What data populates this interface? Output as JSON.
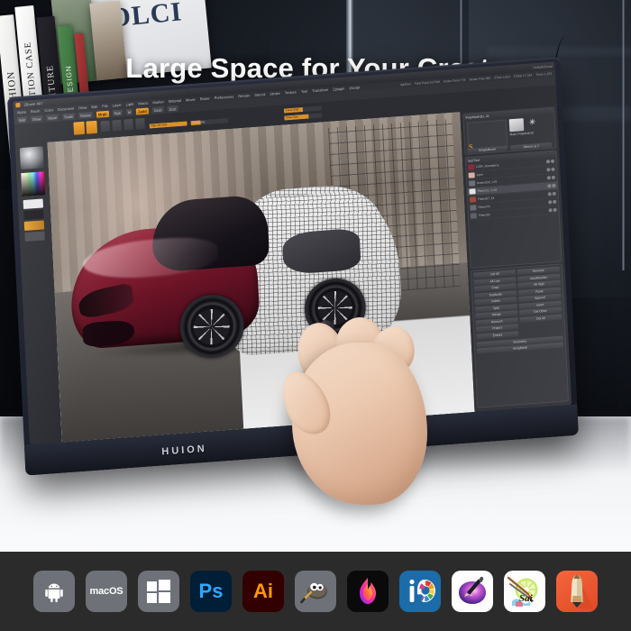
{
  "headline": "Large Space for Your Create",
  "brand": {
    "tablet_logo": "HUION"
  },
  "background": {
    "books": [
      {
        "title": "FASHION",
        "color": "#efefee",
        "text_color": "#1c1c22"
      },
      {
        "title": "DECORATION CASE",
        "color": "#f2f2f1",
        "text_color": "#20202a"
      },
      {
        "title": "FURNITURE",
        "color": "#1d1d22",
        "text_color": "#e8e8ea"
      },
      {
        "title": "About Design",
        "color": "#3b6b3e",
        "text_color": "#f0f0ea"
      },
      {
        "title": "DOLCI",
        "color": "#e9eaec",
        "text_color": "#2a3a55"
      }
    ],
    "magazine_title": "DOLCI"
  },
  "zbrush": {
    "window_title": "ZBrush 4R7",
    "menu_items": [
      "Alpha",
      "Brush",
      "Color",
      "Document",
      "Draw",
      "Edit",
      "File",
      "Layer",
      "Light",
      "Macro",
      "Marker",
      "Material",
      "Movie",
      "Picker",
      "Preferences",
      "Render",
      "Stencil",
      "Stroke",
      "Texture",
      "Tool",
      "Transform",
      "Zplugin",
      "Zscript"
    ],
    "status": {
      "tool": "lightbox",
      "total_points": "Total Point 3,072M",
      "active_points": "Active Point 778",
      "stroke_poly": "Stroke Poly 382",
      "ztools": "ZTool 1,024",
      "ztotal": "ZTotal 17,324",
      "ztime": "Timer 1,152"
    },
    "shelf_items": [
      "Edit",
      "Draw",
      "Move",
      "Scale",
      "Rotate",
      "Mrgb",
      "Rgb",
      "M",
      "Zadd",
      "Zsub",
      "Focal Shift",
      "Draw Size",
      "Z Intensity"
    ],
    "sliders": [
      {
        "label": "Rgb Intensity",
        "value": "100"
      },
      {
        "label": "Z Intensity",
        "value": "25"
      },
      {
        "label": "Focal Shift",
        "value": "0"
      },
      {
        "label": "Draw Size",
        "value": "64"
      }
    ],
    "toggles": [
      "Mrgb",
      "Rgb",
      "M",
      "Zadd",
      "Zsub",
      "Zcut"
    ],
    "subtool_panel": {
      "title": "SubTool",
      "tool_title": "PolyMesh3D_41",
      "tool_buttons": [
        "Copy Tool",
        "Import",
        "Export",
        "Clone",
        "Make PolyMesh3D",
        "SimpleBrush",
        "Fibers1 & 2"
      ],
      "items": [
        {
          "name": "COR_strawberry",
          "visible": true
        },
        {
          "name": "eyes",
          "visible": true
        },
        {
          "name": "lensesCol_L01",
          "visible": true
        },
        {
          "name": "Fibers11_Cut1",
          "visible": true,
          "selected": true
        },
        {
          "name": "Fibers07_Di",
          "visible": true
        },
        {
          "name": "Fibers70",
          "visible": true
        },
        {
          "name": "Fibers62",
          "visible": true
        }
      ]
    },
    "subtool_actions": [
      [
        "List All",
        "Rename"
      ],
      [
        "All Low",
        "AutoReorder"
      ],
      [
        "Copy",
        "All High"
      ],
      [
        "Duplicate",
        "Paste"
      ],
      [
        "Delete",
        "Append"
      ],
      [
        "Split",
        "Insert"
      ],
      [
        "Merge",
        "Del Other"
      ],
      [
        "Remesh",
        "Del All"
      ],
      [
        "Project",
        ""
      ],
      [
        "Extract",
        ""
      ],
      [
        "Geometry",
        ""
      ],
      [
        "ArrayMesh",
        ""
      ]
    ],
    "canvas_object": "Sports car model, half rendered / half wireframe"
  },
  "appbar": {
    "apps": [
      {
        "name": "android",
        "icon": "android-icon",
        "label": ""
      },
      {
        "name": "macos",
        "icon": "macos-icon",
        "label": "macOS"
      },
      {
        "name": "windows",
        "icon": "windows-icon",
        "label": ""
      },
      {
        "name": "photoshop",
        "icon": "photoshop-icon",
        "label": "Ps"
      },
      {
        "name": "illustrator",
        "icon": "illustrator-icon",
        "label": "Ai"
      },
      {
        "name": "gimp",
        "icon": "gimp-icon",
        "label": ""
      },
      {
        "name": "infinite-painter",
        "icon": "flame-icon",
        "label": ""
      },
      {
        "name": "ibis-paint",
        "icon": "ibispaint-icon",
        "label": "iP"
      },
      {
        "name": "krita",
        "icon": "krita-icon",
        "label": ""
      },
      {
        "name": "paint-tool-sai",
        "icon": "sai-icon",
        "label": "Sai"
      },
      {
        "name": "sketchbook",
        "icon": "sketchbook-icon",
        "label": ""
      }
    ]
  },
  "colors": {
    "appbar_bg": "#2b2b2b",
    "headline": "#ffffff",
    "zbrush_accent": "#e09a28",
    "car_body": "#6b1426",
    "tablet_bezel": "#222634"
  }
}
